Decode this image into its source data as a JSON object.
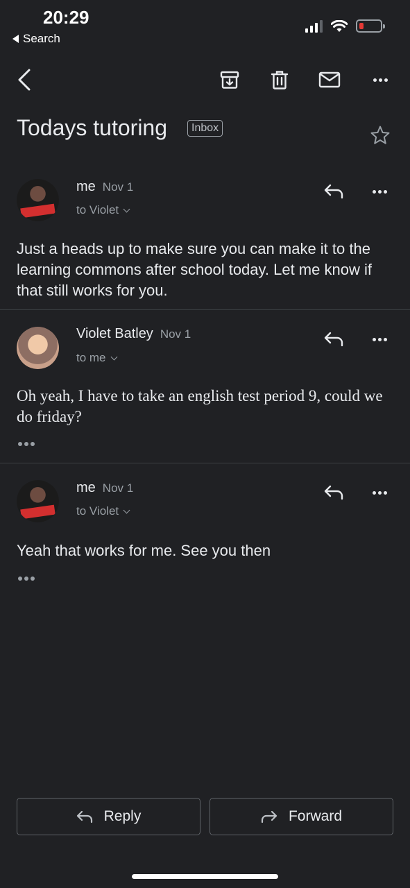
{
  "status_bar": {
    "time": "20:29",
    "back_label": "Search"
  },
  "toolbar": {
    "icons": [
      "back-arrow-icon",
      "archive-icon",
      "trash-icon",
      "mail-icon",
      "more-icon"
    ]
  },
  "thread": {
    "subject": "Todays tutoring",
    "label": "Inbox"
  },
  "messages": [
    {
      "sender": "me",
      "date": "Nov 1",
      "recipient": "to Violet",
      "body": "Just a heads up to make sure you can make it to the learning commons after school today. Let me know if that still works for you."
    },
    {
      "sender": "Violet Batley",
      "date": "Nov 1",
      "recipient": "to me",
      "body": "Oh yeah, I have to take an english test period 9, could we do friday?"
    },
    {
      "sender": "me",
      "date": "Nov 1",
      "recipient": "to Violet",
      "body": "Yeah that works for me. See you then"
    }
  ],
  "actions": {
    "reply_label": "Reply",
    "forward_label": "Forward"
  },
  "colors": {
    "background": "#202124",
    "text": "#e8eaed",
    "secondary": "#9aa0a6",
    "battery_low": "#e53935"
  }
}
